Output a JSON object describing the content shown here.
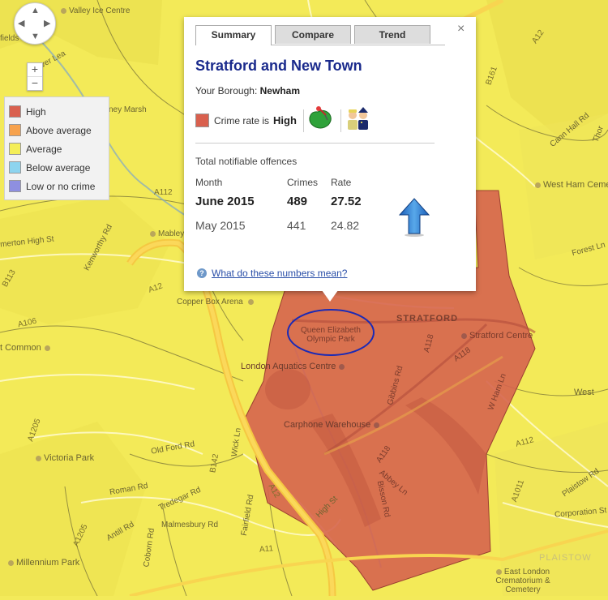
{
  "map": {
    "labels": [
      {
        "id": "valley-ice-centre",
        "text": "Valley Ice Centre",
        "poi": true
      },
      {
        "id": "fields",
        "text": "fields"
      },
      {
        "id": "river-lea",
        "text": "River Lea"
      },
      {
        "id": "hackney-marsh",
        "text": "ney Marsh"
      },
      {
        "id": "a112",
        "text": "A112"
      },
      {
        "id": "homerton-high-st",
        "text": "merton High St"
      },
      {
        "id": "kenworthy-rd",
        "text": "Kenworthy Rd"
      },
      {
        "id": "mabley",
        "text": "Mabley",
        "poi": true
      },
      {
        "id": "b113",
        "text": "B113"
      },
      {
        "id": "a12-n",
        "text": "A12"
      },
      {
        "id": "copper-box-arena",
        "text": "Copper Box Arena",
        "poi": true
      },
      {
        "id": "a106",
        "text": "A106"
      },
      {
        "id": "qe-olympic-park",
        "text": "Queen Elizabeth\nOlympic Park"
      },
      {
        "id": "stratford",
        "text": "STRATFORD"
      },
      {
        "id": "stratford-centre",
        "text": "Stratford Centre",
        "poi": true
      },
      {
        "id": "common",
        "text": "t Common",
        "poi": true
      },
      {
        "id": "london-aquatics-centre",
        "text": "London Aquatics Centre",
        "poi": true
      },
      {
        "id": "a118-n",
        "text": "A118"
      },
      {
        "id": "a118-e",
        "text": "A118"
      },
      {
        "id": "gibbins-rd",
        "text": "Gibbins Rd"
      },
      {
        "id": "west-ham-lane",
        "text": "W Ham Ln"
      },
      {
        "id": "carphone-warehouse",
        "text": "Carphone Warehouse",
        "poi": true
      },
      {
        "id": "old-ford-rd",
        "text": "Old Ford Rd"
      },
      {
        "id": "a1205-n",
        "text": "A1205"
      },
      {
        "id": "victoria-park",
        "text": "Victoria Park",
        "poi": true
      },
      {
        "id": "b142",
        "text": "B142"
      },
      {
        "id": "wick-ln",
        "text": "Wick Ln"
      },
      {
        "id": "a12-s",
        "text": "A12"
      },
      {
        "id": "a118-s",
        "text": "A118"
      },
      {
        "id": "abbey-ln",
        "text": "Abbey Ln"
      },
      {
        "id": "bisson-rd",
        "text": "Bisson Rd"
      },
      {
        "id": "roman-rd",
        "text": "Roman Rd"
      },
      {
        "id": "tredegar-rd",
        "text": "Tredegar Rd"
      },
      {
        "id": "antill-rd",
        "text": "Antill Rd"
      },
      {
        "id": "malmesbury-rd",
        "text": "Malmesbury Rd"
      },
      {
        "id": "fairfield-rd",
        "text": "Fairfield Rd"
      },
      {
        "id": "high-st",
        "text": "High St"
      },
      {
        "id": "a1205-s",
        "text": "A1205"
      },
      {
        "id": "coborn-rd",
        "text": "Coborn Rd"
      },
      {
        "id": "a11",
        "text": "A11"
      },
      {
        "id": "millennium-park",
        "text": "Millennium Park",
        "poi": true
      },
      {
        "id": "a1011",
        "text": "A1011"
      },
      {
        "id": "west-ham-cemetery",
        "text": "West Ham Cemetery",
        "poi": true
      },
      {
        "id": "cann-hall-rd",
        "text": "Cann Hall Rd"
      },
      {
        "id": "forest-ln",
        "text": "Forest Ln"
      },
      {
        "id": "b161",
        "text": "B161"
      },
      {
        "id": "a112-e",
        "text": "A112"
      },
      {
        "id": "plaistow-rd",
        "text": "Plaistow Rd"
      },
      {
        "id": "corporation-st",
        "text": "Corporation St"
      },
      {
        "id": "plaistow",
        "text": "PLAISTOW"
      },
      {
        "id": "east-london-crematorium",
        "text": "East London\nCrematorium & Cemetery",
        "poi": true
      },
      {
        "id": "west-ham",
        "text": "West",
        "poi": true
      },
      {
        "id": "a12-ne",
        "text": "A12"
      },
      {
        "id": "thor",
        "text": "Thor"
      }
    ]
  },
  "nav": {
    "up": "▲",
    "down": "▼",
    "left": "◀",
    "right": "▶",
    "zoom_in": "+",
    "zoom_out": "−"
  },
  "legend": {
    "items": [
      {
        "label": "High",
        "color": "#d9604e"
      },
      {
        "label": "Above average",
        "color": "#f7a24d"
      },
      {
        "label": "Average",
        "color": "#f4ee58"
      },
      {
        "label": "Below average",
        "color": "#8dd4ef"
      },
      {
        "label": "Low or no crime",
        "color": "#8e8fe0"
      }
    ]
  },
  "info": {
    "close_label": "×",
    "tabs": [
      {
        "label": "Summary",
        "active": true
      },
      {
        "label": "Compare",
        "active": false
      },
      {
        "label": "Trend",
        "active": false
      }
    ],
    "area_title": "Stratford and New Town",
    "borough_prefix": "Your Borough:",
    "borough_name": "Newham",
    "crime_rate_prefix": "Crime rate is",
    "crime_rate_level": "High",
    "crime_rate_color": "#d9604e",
    "section_title": "Total notifiable offences",
    "table": {
      "headers": [
        "Month",
        "Crimes",
        "Rate"
      ],
      "rows": [
        {
          "month": "June 2015",
          "crimes": "489",
          "rate": "27.52"
        },
        {
          "month": "May 2015",
          "crimes": "441",
          "rate": "24.82"
        }
      ]
    },
    "trend_direction": "up",
    "help_label": "What do these numbers mean?"
  }
}
